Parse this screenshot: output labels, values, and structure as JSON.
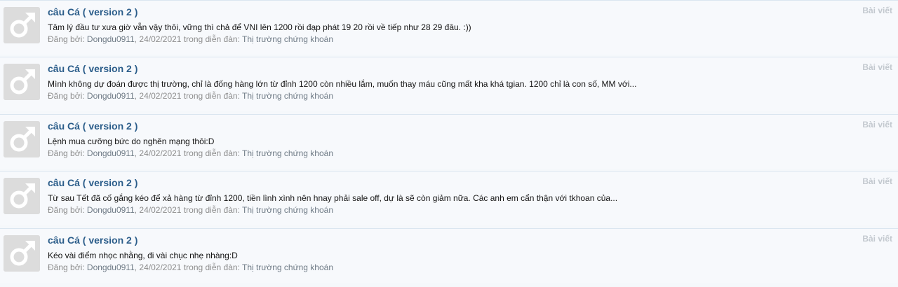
{
  "results": [
    {
      "avatar_icon": "male-symbol-icon",
      "title": "câu Cá ( version 2 )",
      "snippet": "Tâm lý đầu tư xưa giờ vẫn vậy thôi, vững thì chả để VNI lên 1200 rồi đạp phát 19 20 rồi về tiếp như 28 29 đâu. :))",
      "meta_prefix": "Đăng bởi: ",
      "author": "Dongdu0911",
      "meta_middle": ", 24/02/2021 trong diễn đàn: ",
      "forum": "Thị trường chứng khoán",
      "badge": "Bài viết"
    },
    {
      "avatar_icon": "male-symbol-icon",
      "title": "câu Cá ( version 2 )",
      "snippet": "Mình không dự đoán được thị trường, chỉ là đống hàng lớn từ đỉnh 1200 còn nhiều lắm, muốn thay máu cũng mất kha khá tgian. 1200 chỉ là con số, MM với...",
      "meta_prefix": "Đăng bởi: ",
      "author": "Dongdu0911",
      "meta_middle": ", 24/02/2021 trong diễn đàn: ",
      "forum": "Thị trường chứng khoán",
      "badge": "Bài viết"
    },
    {
      "avatar_icon": "male-symbol-icon",
      "title": "câu Cá ( version 2 )",
      "snippet": "Lệnh mua cưỡng bức do nghẽn mạng thôi:D",
      "meta_prefix": "Đăng bởi: ",
      "author": "Dongdu0911",
      "meta_middle": ", 24/02/2021 trong diễn đàn: ",
      "forum": "Thị trường chứng khoán",
      "badge": "Bài viết"
    },
    {
      "avatar_icon": "male-symbol-icon",
      "title": "câu Cá ( version 2 )",
      "snippet": "Từ sau Tết đã cố gắng kéo để xả hàng từ đỉnh 1200, tiền lình xình nên hnay phải sale off, dự là sẽ còn giảm nữa. Các anh em cẩn thận với tkhoan của...",
      "meta_prefix": "Đăng bởi: ",
      "author": "Dongdu0911",
      "meta_middle": ", 24/02/2021 trong diễn đàn: ",
      "forum": "Thị trường chứng khoán",
      "badge": "Bài viết"
    },
    {
      "avatar_icon": "male-symbol-icon",
      "title": "câu Cá ( version 2 )",
      "snippet": "Kéo vài điểm nhọc nhằng, đi vài chục nhẹ nhàng:D",
      "meta_prefix": "Đăng bởi: ",
      "author": "Dongdu0911",
      "meta_middle": ", 24/02/2021 trong diễn đàn: ",
      "forum": "Thị trường chứng khoán",
      "badge": "Bài viết"
    }
  ]
}
